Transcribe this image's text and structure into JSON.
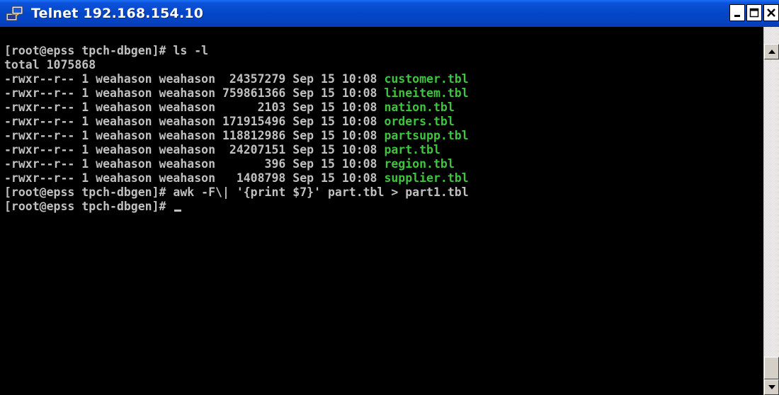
{
  "window": {
    "title": "Telnet 192.168.154.10",
    "minimize_label": "_",
    "maximize_label": "□",
    "close_label": "×"
  },
  "terminal": {
    "lines": [
      {
        "prefix": "[root@epss tpch-dbgen]# ls -l",
        "file": ""
      },
      {
        "prefix": "total 1075868",
        "file": ""
      },
      {
        "prefix": "-rwxr--r-- 1 weahason weahason  24357279 Sep 15 10:08 ",
        "file": "customer.tbl"
      },
      {
        "prefix": "-rwxr--r-- 1 weahason weahason 759861366 Sep 15 10:08 ",
        "file": "lineitem.tbl"
      },
      {
        "prefix": "-rwxr--r-- 1 weahason weahason      2103 Sep 15 10:08 ",
        "file": "nation.tbl"
      },
      {
        "prefix": "-rwxr--r-- 1 weahason weahason 171915496 Sep 15 10:08 ",
        "file": "orders.tbl"
      },
      {
        "prefix": "-rwxr--r-- 1 weahason weahason 118812986 Sep 15 10:08 ",
        "file": "partsupp.tbl"
      },
      {
        "prefix": "-rwxr--r-- 1 weahason weahason  24207151 Sep 15 10:08 ",
        "file": "part.tbl"
      },
      {
        "prefix": "-rwxr--r-- 1 weahason weahason       396 Sep 15 10:08 ",
        "file": "region.tbl"
      },
      {
        "prefix": "-rwxr--r-- 1 weahason weahason   1408798 Sep 15 10:08 ",
        "file": "supplier.tbl"
      },
      {
        "prefix": "[root@epss tpch-dbgen]# awk -F\\| '{print $7}' part.tbl > part1.tbl",
        "file": ""
      },
      {
        "prefix": "[root@epss tpch-dbgen]# ",
        "file": ""
      }
    ]
  },
  "colors": {
    "terminal_text": "#c0c0c0",
    "filename": "#3ec43e",
    "background": "#000000",
    "titlebar": "#0446c8"
  },
  "icons": {
    "title_icon": "telnet-computer-icon",
    "scroll_up": "arrow-up-icon",
    "scroll_down": "arrow-down-icon"
  }
}
